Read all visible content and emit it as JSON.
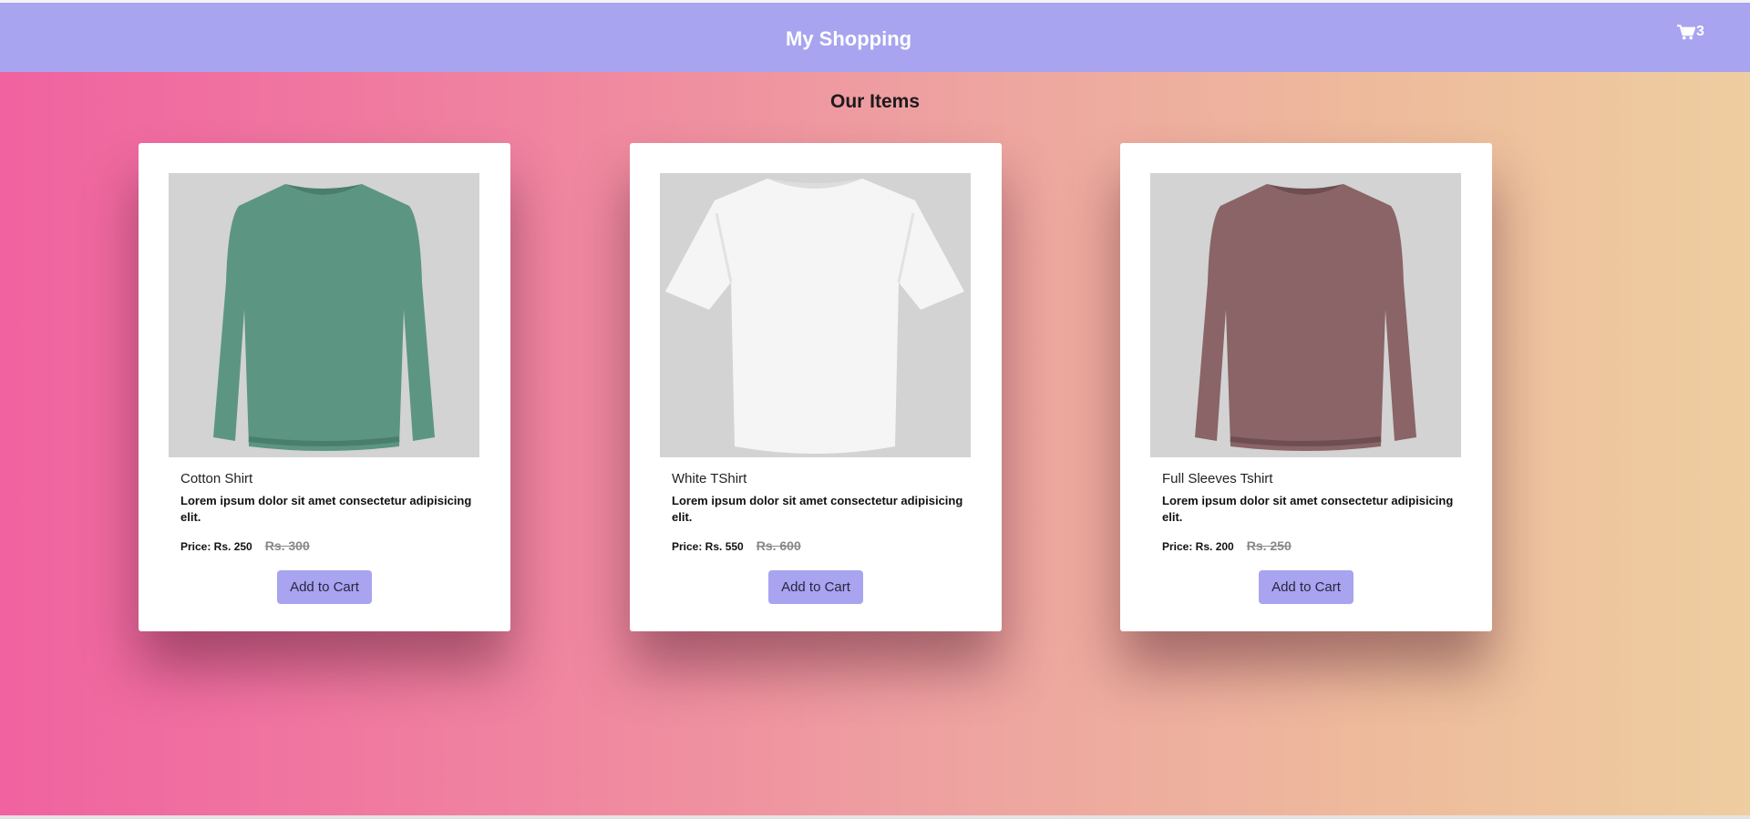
{
  "navbar": {
    "brand": "My Shopping",
    "cart_icon": "cart-icon",
    "cart_count": "3",
    "color": "#a8a4ef"
  },
  "main": {
    "section_title": "Our Items",
    "gradient": [
      "#f062a0",
      "#f086a0",
      "#eea3a0",
      "#eebc9c",
      "#eecda0"
    ]
  },
  "products": [
    {
      "name": "Cotton Shirt",
      "description": "Lorem ipsum dolor sit amet consectetur adipisicing elit.",
      "price": "Price: Rs. 250",
      "old_price": "Rs. 300",
      "button": "Add to Cart",
      "image": "green-long-sleeve-shirt",
      "image_color": "#5c9682"
    },
    {
      "name": "White TShirt",
      "description": "Lorem ipsum dolor sit amet consectetur adipisicing elit.",
      "price": "Price: Rs. 550",
      "old_price": "Rs. 600",
      "button": "Add to Cart",
      "image": "white-short-sleeve-tshirt",
      "image_color": "#f4f4f4"
    },
    {
      "name": "Full Sleeves Tshirt",
      "description": "Lorem ipsum dolor sit amet consectetur adipisicing elit.",
      "price": "Price: Rs. 200",
      "old_price": "Rs. 250",
      "button": "Add to Cart",
      "image": "maroon-long-sleeve-shirt",
      "image_color": "#8a6466"
    }
  ]
}
